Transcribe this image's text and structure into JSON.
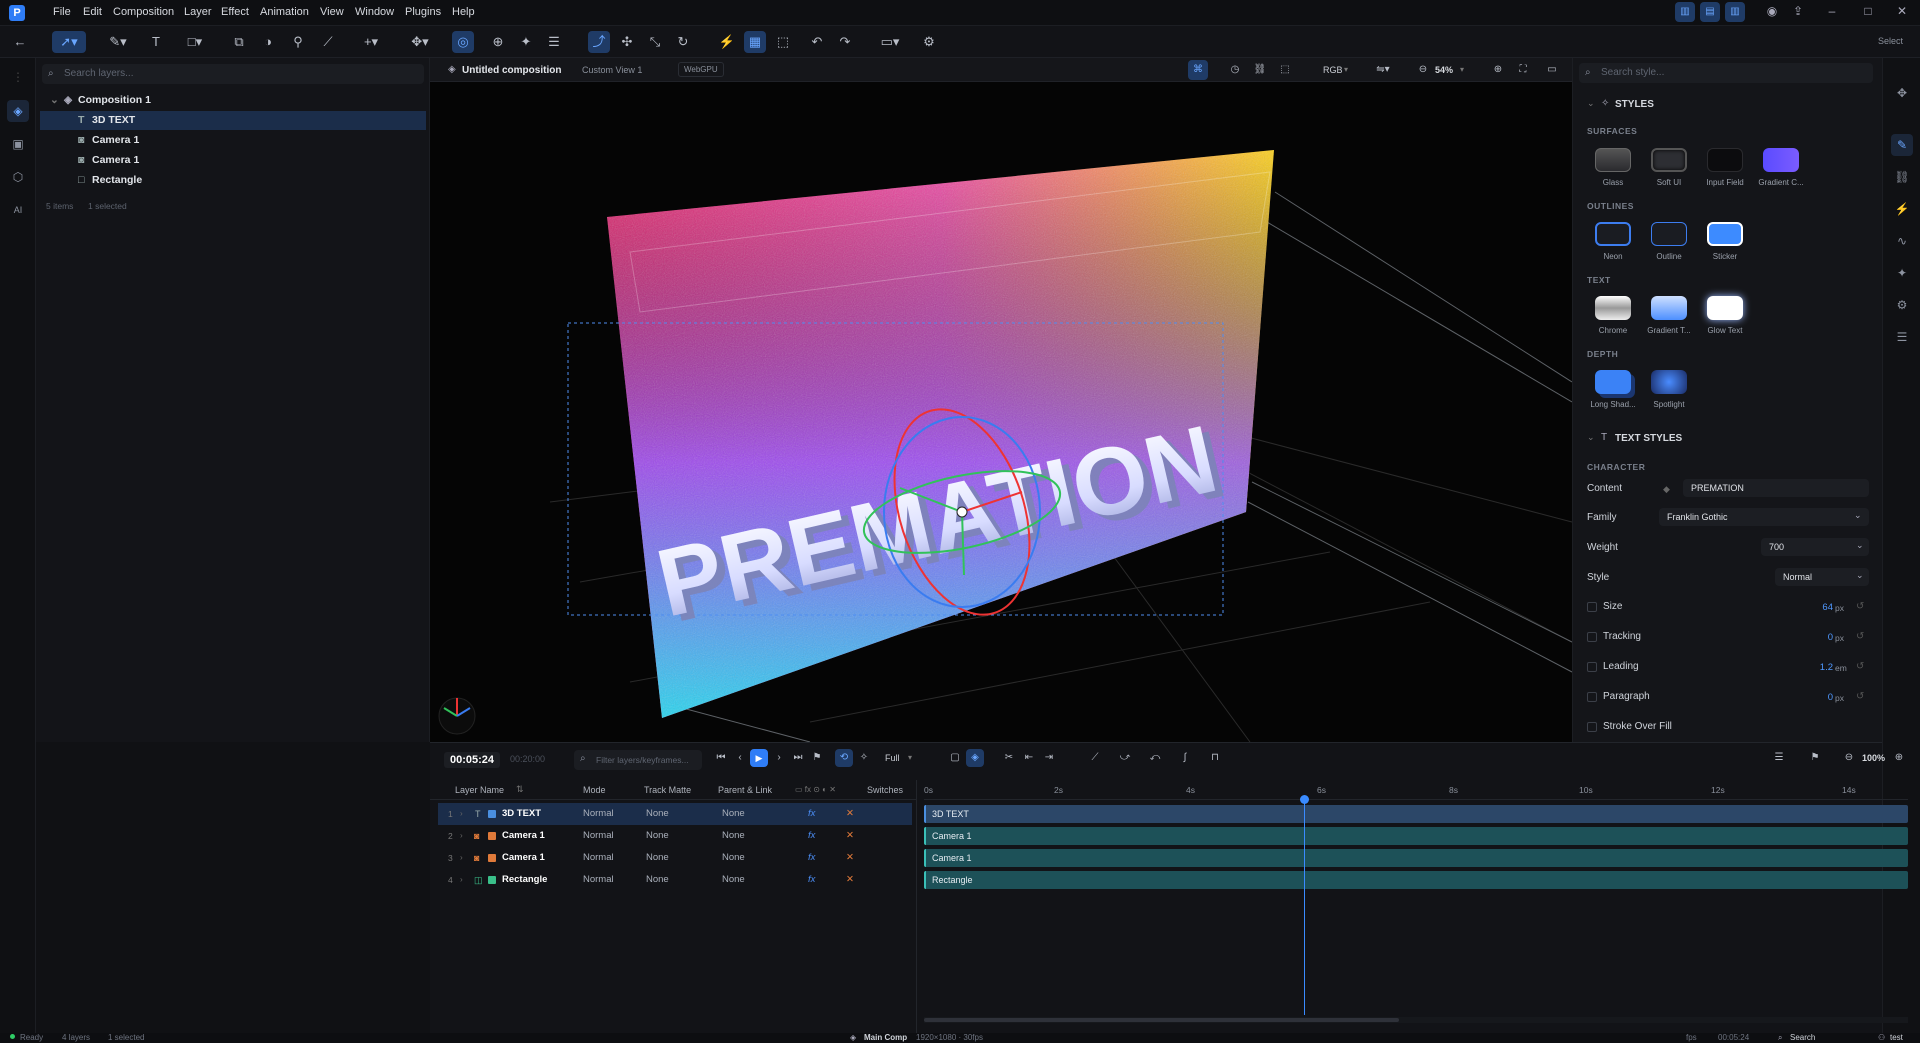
{
  "menu": {
    "logo": "P",
    "items": [
      "File",
      "Edit",
      "Composition",
      "Layer",
      "Effect",
      "Animation",
      "View",
      "Window",
      "Plugins",
      "Help"
    ],
    "right_label": "Select"
  },
  "layers_panel": {
    "search_placeholder": "Search layers...",
    "composition": "Composition 1",
    "items": [
      {
        "label": "3D TEXT",
        "icon": "text-icon"
      },
      {
        "label": "Camera 1",
        "icon": "camera-icon"
      },
      {
        "label": "Camera 1",
        "icon": "camera-icon"
      },
      {
        "label": "Rectangle",
        "icon": "rectangle-icon"
      }
    ],
    "footer_count": "5 items",
    "footer_selected": "1 selected"
  },
  "viewport": {
    "tab_title": "Untitled composition",
    "view_label": "Custom View 1",
    "renderer": "WebGPU",
    "channel": "RGB",
    "zoom": "54%",
    "scene_text": "PREMATION"
  },
  "styles": {
    "search_placeholder": "Search style...",
    "header": "STYLES",
    "surfaces_label": "SURFACES",
    "surfaces": [
      "Glass",
      "Soft UI",
      "Input Field",
      "Gradient C..."
    ],
    "outlines_label": "OUTLINES",
    "outlines": [
      "Neon",
      "Outline",
      "Sticker"
    ],
    "text_label": "TEXT",
    "text_items": [
      "Chrome",
      "Gradient T...",
      "Glow Text"
    ],
    "depth_label": "DEPTH",
    "depth_items": [
      "Long Shad...",
      "Spotlight"
    ]
  },
  "text_styles": {
    "header": "TEXT STYLES",
    "character_label": "CHARACTER",
    "content_label": "Content",
    "content_value": "PREMATION",
    "family_label": "Family",
    "family_value": "Franklin Gothic",
    "weight_label": "Weight",
    "weight_value": "700",
    "style_label": "Style",
    "style_value": "Normal",
    "size_label": "Size",
    "size_value": "64",
    "size_unit": "px",
    "tracking_label": "Tracking",
    "tracking_value": "0",
    "tracking_unit": "px",
    "leading_label": "Leading",
    "leading_value": "1.2",
    "leading_unit": "em",
    "paragraph_label": "Paragraph",
    "paragraph_value": "0",
    "paragraph_unit": "px",
    "stroke_label": "Stroke Over Fill"
  },
  "timeline": {
    "current_time": "00:05:24",
    "duration": "00:20:00",
    "filter_placeholder": "Filter layers/keyframes...",
    "resolution": "Full",
    "zoom": "100%",
    "columns": [
      "Layer Name",
      "Mode",
      "Track Matte",
      "Parent & Link",
      "Switches"
    ],
    "ruler": [
      "0s",
      "2s",
      "4s",
      "6s",
      "8s",
      "10s",
      "12s",
      "14s"
    ],
    "rows": [
      {
        "index": "1",
        "name": "3D TEXT",
        "mode": "Normal",
        "matte": "None",
        "parent": "None",
        "color": "#4a8fe0"
      },
      {
        "index": "2",
        "name": "Camera 1",
        "mode": "Normal",
        "matte": "None",
        "parent": "None",
        "color": "#e07a3a"
      },
      {
        "index": "3",
        "name": "Camera 1",
        "mode": "Normal",
        "matte": "None",
        "parent": "None",
        "color": "#e07a3a"
      },
      {
        "index": "4",
        "name": "Rectangle",
        "mode": "Normal",
        "matte": "None",
        "parent": "None",
        "color": "#3ac08a"
      }
    ],
    "playhead_fraction": 0.386
  },
  "status": {
    "ready": "Ready",
    "layers": "4 layers",
    "selected": "1 selected",
    "comp": "Main Comp",
    "comp_info": "1920×1080 · 30fps",
    "fps": "fps",
    "time": "00:05:24",
    "search": "Search",
    "user": "test"
  }
}
